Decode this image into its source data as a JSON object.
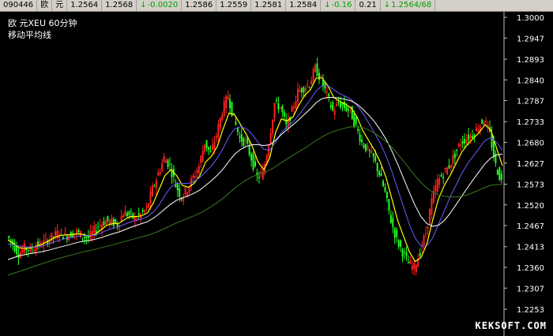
{
  "quote_bar": {
    "code": "090446",
    "name_part1": "欧",
    "name_part2": "元",
    "open": "1.2564",
    "high": "1.2568",
    "change": "-0.0020",
    "bid": "1.2586",
    "ask": "1.2559",
    "v1": "1.2581",
    "v2": "1.2584",
    "pct_change": "-0.16",
    "spread": "0.21",
    "last_info": "1.2564/68"
  },
  "legend": {
    "title": "欧  元XEU  60分钟",
    "indicator": "移动平均线"
  },
  "watermark": "KEKSOFT.COM",
  "colors": {
    "background": "#000000",
    "axis": "#c0c0c0",
    "up_candle": "#ff2020",
    "down_candle": "#20ff20",
    "ma_fast": "#ffff00",
    "ma_mid": "#6a5cff",
    "ma_slow": "#ffffff",
    "ma_long": "#3a7a20"
  },
  "chart_data": {
    "type": "line",
    "title": "",
    "xlabel": "",
    "ylabel": "",
    "ylim": [
      1.2225,
      1.3
    ],
    "y_ticks": [
      "1.3000",
      "1.2947",
      "1.2893",
      "1.2840",
      "1.2787",
      "1.2733",
      "1.2680",
      "1.2627",
      "1.2573",
      "1.2520",
      "1.2467",
      "1.2413",
      "1.2360",
      "1.2307",
      "1.2253"
    ],
    "price_series": [
      1.244,
      1.242,
      1.2395,
      1.241,
      1.2405,
      1.2415,
      1.242,
      1.243,
      1.244,
      1.245,
      1.244,
      1.2445,
      1.245,
      1.244,
      1.2435,
      1.2455,
      1.247,
      1.248,
      1.2475,
      1.247,
      1.25,
      1.2495,
      1.2485,
      1.2495,
      1.251,
      1.256,
      1.26,
      1.264,
      1.262,
      1.257,
      1.254,
      1.256,
      1.259,
      1.262,
      1.268,
      1.265,
      1.27,
      1.276,
      1.28,
      1.274,
      1.269,
      1.268,
      1.264,
      1.259,
      1.26,
      1.268,
      1.278,
      1.277,
      1.272,
      1.276,
      1.281,
      1.282,
      1.283,
      1.287,
      1.284,
      1.28,
      1.276,
      1.278,
      1.277,
      1.276,
      1.272,
      1.268,
      1.266,
      1.264,
      1.26,
      1.255,
      1.248,
      1.243,
      1.24,
      1.237,
      1.236,
      1.24,
      1.245,
      1.253,
      1.258,
      1.26,
      1.262,
      1.265,
      1.268,
      1.269,
      1.27,
      1.272,
      1.274,
      1.27,
      1.262,
      1.258
    ],
    "series": [
      {
        "values": [
          1.243,
          1.242,
          1.241,
          1.2408,
          1.241,
          1.2415,
          1.242,
          1.2428,
          1.2436,
          1.2442,
          1.2443,
          1.2444,
          1.2446,
          1.2444,
          1.244,
          1.2445,
          1.2456,
          1.2468,
          1.2472,
          1.2472,
          1.2482,
          1.249,
          1.249,
          1.2492,
          1.25,
          1.2525,
          1.256,
          1.2595,
          1.261,
          1.2595,
          1.257,
          1.2565,
          1.2575,
          1.2595,
          1.263,
          1.2645,
          1.267,
          1.2715,
          1.2755,
          1.275,
          1.2725,
          1.27,
          1.267,
          1.263,
          1.261,
          1.264,
          1.2705,
          1.274,
          1.2735,
          1.2745,
          1.2775,
          1.28,
          1.2815,
          1.2845,
          1.2845,
          1.2825,
          1.2795,
          1.2785,
          1.2778,
          1.2768,
          1.2745,
          1.271,
          1.2685,
          1.266,
          1.263,
          1.259,
          1.2535,
          1.248,
          1.244,
          1.24,
          1.2375,
          1.2385,
          1.242,
          1.248,
          1.2535,
          1.257,
          1.2595,
          1.2625,
          1.2655,
          1.2675,
          1.269,
          1.2705,
          1.2725,
          1.2712,
          1.2665,
          1.262
        ]
      },
      {
        "values": [
          1.242,
          1.2418,
          1.2415,
          1.2412,
          1.2412,
          1.2413,
          1.2415,
          1.242,
          1.2425,
          1.243,
          1.2434,
          1.2437,
          1.244,
          1.2441,
          1.2441,
          1.2443,
          1.2448,
          1.2455,
          1.246,
          1.2464,
          1.247,
          1.2476,
          1.248,
          1.2484,
          1.249,
          1.2502,
          1.252,
          1.2545,
          1.2565,
          1.2575,
          1.2575,
          1.2575,
          1.258,
          1.259,
          1.2605,
          1.262,
          1.264,
          1.2665,
          1.2695,
          1.2715,
          1.272,
          1.2715,
          1.27,
          1.268,
          1.2662,
          1.266,
          1.268,
          1.2705,
          1.272,
          1.2732,
          1.275,
          1.277,
          1.279,
          1.2812,
          1.2825,
          1.2825,
          1.2815,
          1.2805,
          1.2798,
          1.279,
          1.2775,
          1.2755,
          1.273,
          1.2705,
          1.2678,
          1.2645,
          1.2605,
          1.256,
          1.2515,
          1.247,
          1.2435,
          1.2415,
          1.2415,
          1.2435,
          1.247,
          1.2505,
          1.254,
          1.257,
          1.26,
          1.2625,
          1.2645,
          1.2665,
          1.2685,
          1.2692,
          1.268,
          1.266
        ]
      },
      {
        "values": [
          1.238,
          1.2385,
          1.239,
          1.2393,
          1.2396,
          1.2398,
          1.2401,
          1.2404,
          1.2408,
          1.2412,
          1.2416,
          1.242,
          1.2424,
          1.2427,
          1.2429,
          1.2432,
          1.2436,
          1.2441,
          1.2446,
          1.245,
          1.2456,
          1.2462,
          1.2467,
          1.2472,
          1.2477,
          1.2486,
          1.2497,
          1.251,
          1.2522,
          1.2532,
          1.2538,
          1.2543,
          1.255,
          1.2558,
          1.257,
          1.2582,
          1.2596,
          1.2612,
          1.2632,
          1.265,
          1.2662,
          1.267,
          1.2674,
          1.2674,
          1.2672,
          1.2674,
          1.2685,
          1.27,
          1.2713,
          1.2725,
          1.2738,
          1.2752,
          1.2766,
          1.2782,
          1.2792,
          1.2795,
          1.2795,
          1.2793,
          1.279,
          1.2786,
          1.2778,
          1.2765,
          1.275,
          1.2733,
          1.2712,
          1.2688,
          1.2658,
          1.2624,
          1.2588,
          1.2552,
          1.2518,
          1.249,
          1.2472,
          1.2465,
          1.2468,
          1.248,
          1.2498,
          1.252,
          1.2542,
          1.2564,
          1.2585,
          1.2605,
          1.2625,
          1.264,
          1.2648,
          1.265
        ]
      },
      {
        "values": [
          1.234,
          1.2345,
          1.235,
          1.2355,
          1.236,
          1.2365,
          1.237,
          1.2375,
          1.238,
          1.2384,
          1.2388,
          1.2392,
          1.2396,
          1.24,
          1.2403,
          1.2406,
          1.241,
          1.2414,
          1.2418,
          1.2422,
          1.2426,
          1.243,
          1.2434,
          1.2438,
          1.2442,
          1.2447,
          1.2453,
          1.246,
          1.2467,
          1.2474,
          1.248,
          1.2486,
          1.2492,
          1.2499,
          1.2507,
          1.2516,
          1.2526,
          1.2537,
          1.255,
          1.2563,
          1.2574,
          1.2584,
          1.2592,
          1.2598,
          1.2603,
          1.2609,
          1.2618,
          1.2628,
          1.2638,
          1.2647,
          1.2656,
          1.2665,
          1.2675,
          1.2685,
          1.2694,
          1.2702,
          1.2708,
          1.2713,
          1.2717,
          1.272,
          1.272,
          1.2718,
          1.2712,
          1.2704,
          1.2694,
          1.2682,
          1.2667,
          1.265,
          1.2632,
          1.2613,
          1.2594,
          1.2577,
          1.2563,
          1.2553,
          1.2546,
          1.2542,
          1.254,
          1.254,
          1.2542,
          1.2546,
          1.2552,
          1.2558,
          1.2565,
          1.257,
          1.2572,
          1.2572
        ]
      }
    ]
  }
}
